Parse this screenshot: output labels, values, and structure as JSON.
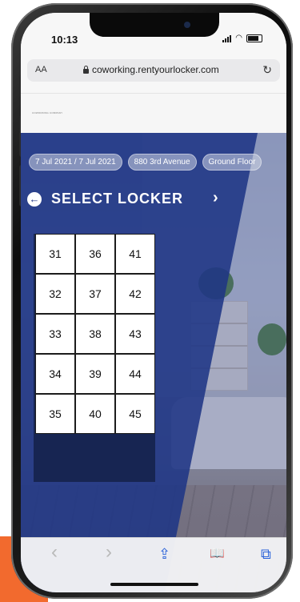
{
  "status": {
    "time": "10:13"
  },
  "browser": {
    "text_size_label": "AA",
    "url": "coworking.rentyourlocker.com"
  },
  "site": {
    "logo_text": "COWORKING COMPANY"
  },
  "booking": {
    "dates": "7 Jul 2021 / 7 Jul 2021",
    "address": "880 3rd Avenue",
    "floor": "Ground Floor"
  },
  "page": {
    "title": "SELECT LOCKER"
  },
  "lockers": [
    "31",
    "36",
    "41",
    "32",
    "37",
    "42",
    "33",
    "38",
    "43",
    "34",
    "39",
    "44",
    "35",
    "40",
    "45"
  ],
  "toolbar": {
    "back": "‹",
    "forward": "›",
    "share": "⇪",
    "bookmarks": "📖",
    "tabs": "⧉"
  },
  "colors": {
    "primary": "#1f3685",
    "accent": "#f26a2e"
  }
}
